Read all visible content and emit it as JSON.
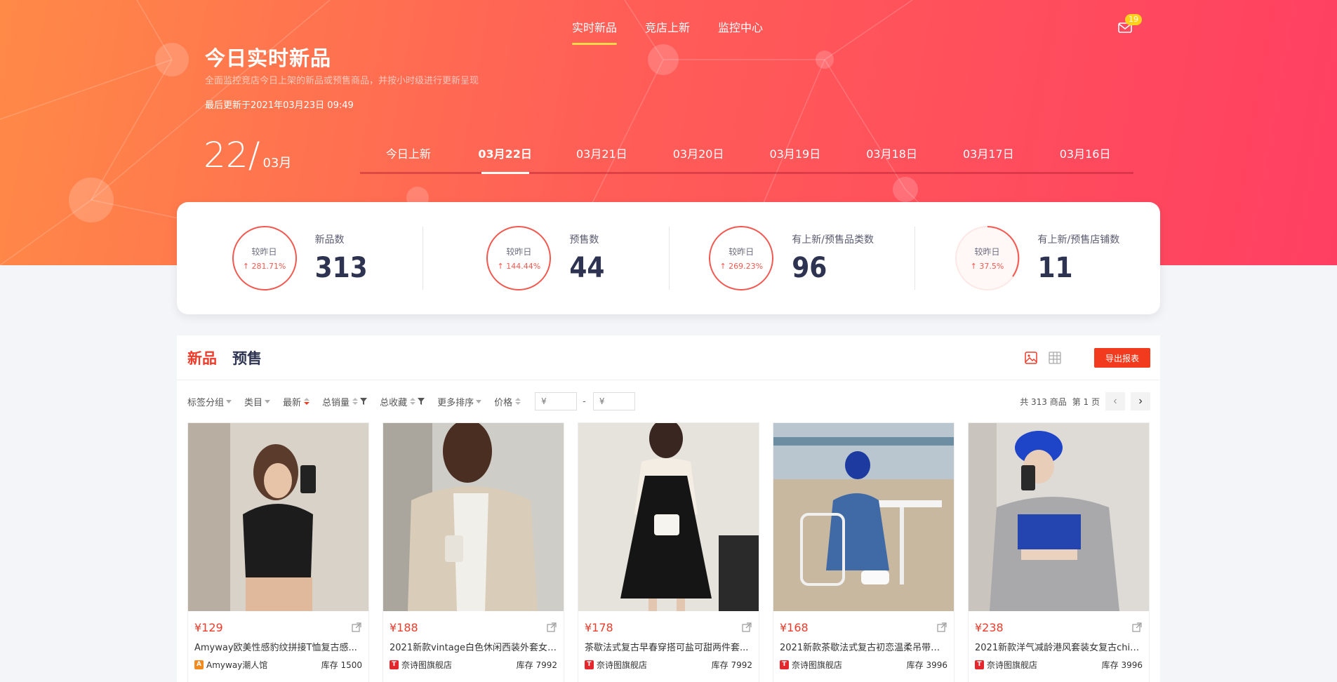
{
  "nav": {
    "items": [
      "实时新品",
      "竞店上新",
      "监控中心"
    ],
    "active_index": 0,
    "mail_badge": "19"
  },
  "hero": {
    "title": "今日实时新品",
    "subtitle": "全面监控竞店今日上架的新品或预售商品，并按小时级进行更新呈现",
    "updated": "最后更新于2021年03月23日 09:49",
    "big_day": "22",
    "big_month": "03月"
  },
  "date_tabs": [
    "今日上新",
    "03月22日",
    "03月21日",
    "03月20日",
    "03月19日",
    "03月18日",
    "03月17日",
    "03月16日"
  ],
  "stats": [
    {
      "ring_label": "较昨日",
      "change": "↑ 281.71%",
      "label": "新品数",
      "value": "313"
    },
    {
      "ring_label": "较昨日",
      "change": "↑ 144.44%",
      "label": "预售数",
      "value": "44"
    },
    {
      "ring_label": "较昨日",
      "change": "↑ 269.23%",
      "label": "有上新/预售品类数",
      "value": "96"
    },
    {
      "ring_label": "较昨日",
      "change": "↑ 37.5%",
      "label": "有上新/预售店铺数",
      "value": "11"
    }
  ],
  "colors": {
    "accent": "#ee3b2a",
    "ring": "#f2584f",
    "badge": "#ffd11a"
  },
  "panel": {
    "tabs": [
      "新品",
      "预售"
    ],
    "export_label": "导出报表",
    "filters": {
      "tag_group": "标签分组",
      "category": "类目",
      "newest": "最新",
      "total_sales": "总销量",
      "total_fav": "总收藏",
      "more_sort": "更多排序",
      "price": "价格"
    },
    "price_min_placeholder": "¥",
    "price_max_placeholder": "¥",
    "price_dash": "-",
    "pager": {
      "total": "共 313 商品",
      "page": "第 1 页",
      "prev": "‹",
      "next": "›"
    }
  },
  "products": [
    {
      "price": "¥129",
      "title": "Amyway欧美性感豹纹拼接T恤复古感...",
      "shop": "Amyway潮人馆",
      "shop_mark": "A",
      "shop_color": "#f28a1d",
      "stock": "库存 1500"
    },
    {
      "price": "¥188",
      "title": "2021新款vintage白色休闲西装外套女in...",
      "shop": "奈诗图旗舰店",
      "shop_mark": "T",
      "shop_color": "#e4262d",
      "stock": "库存 7992"
    },
    {
      "price": "¥178",
      "title": "茶歇法式复古早春穿搭可盐可甜两件套...",
      "shop": "奈诗图旗舰店",
      "shop_mark": "T",
      "shop_color": "#e4262d",
      "stock": "库存 7992"
    },
    {
      "price": "¥168",
      "title": "2021新款茶歇法式复古初恋温柔吊带设...",
      "shop": "奈诗图旗舰店",
      "shop_mark": "T",
      "shop_color": "#e4262d",
      "stock": "库存 3996"
    },
    {
      "price": "¥238",
      "title": "2021新款洋气减龄港风套装女复古chic...",
      "shop": "奈诗图旗舰店",
      "shop_mark": "T",
      "shop_color": "#e4262d",
      "stock": "库存 3996"
    }
  ]
}
